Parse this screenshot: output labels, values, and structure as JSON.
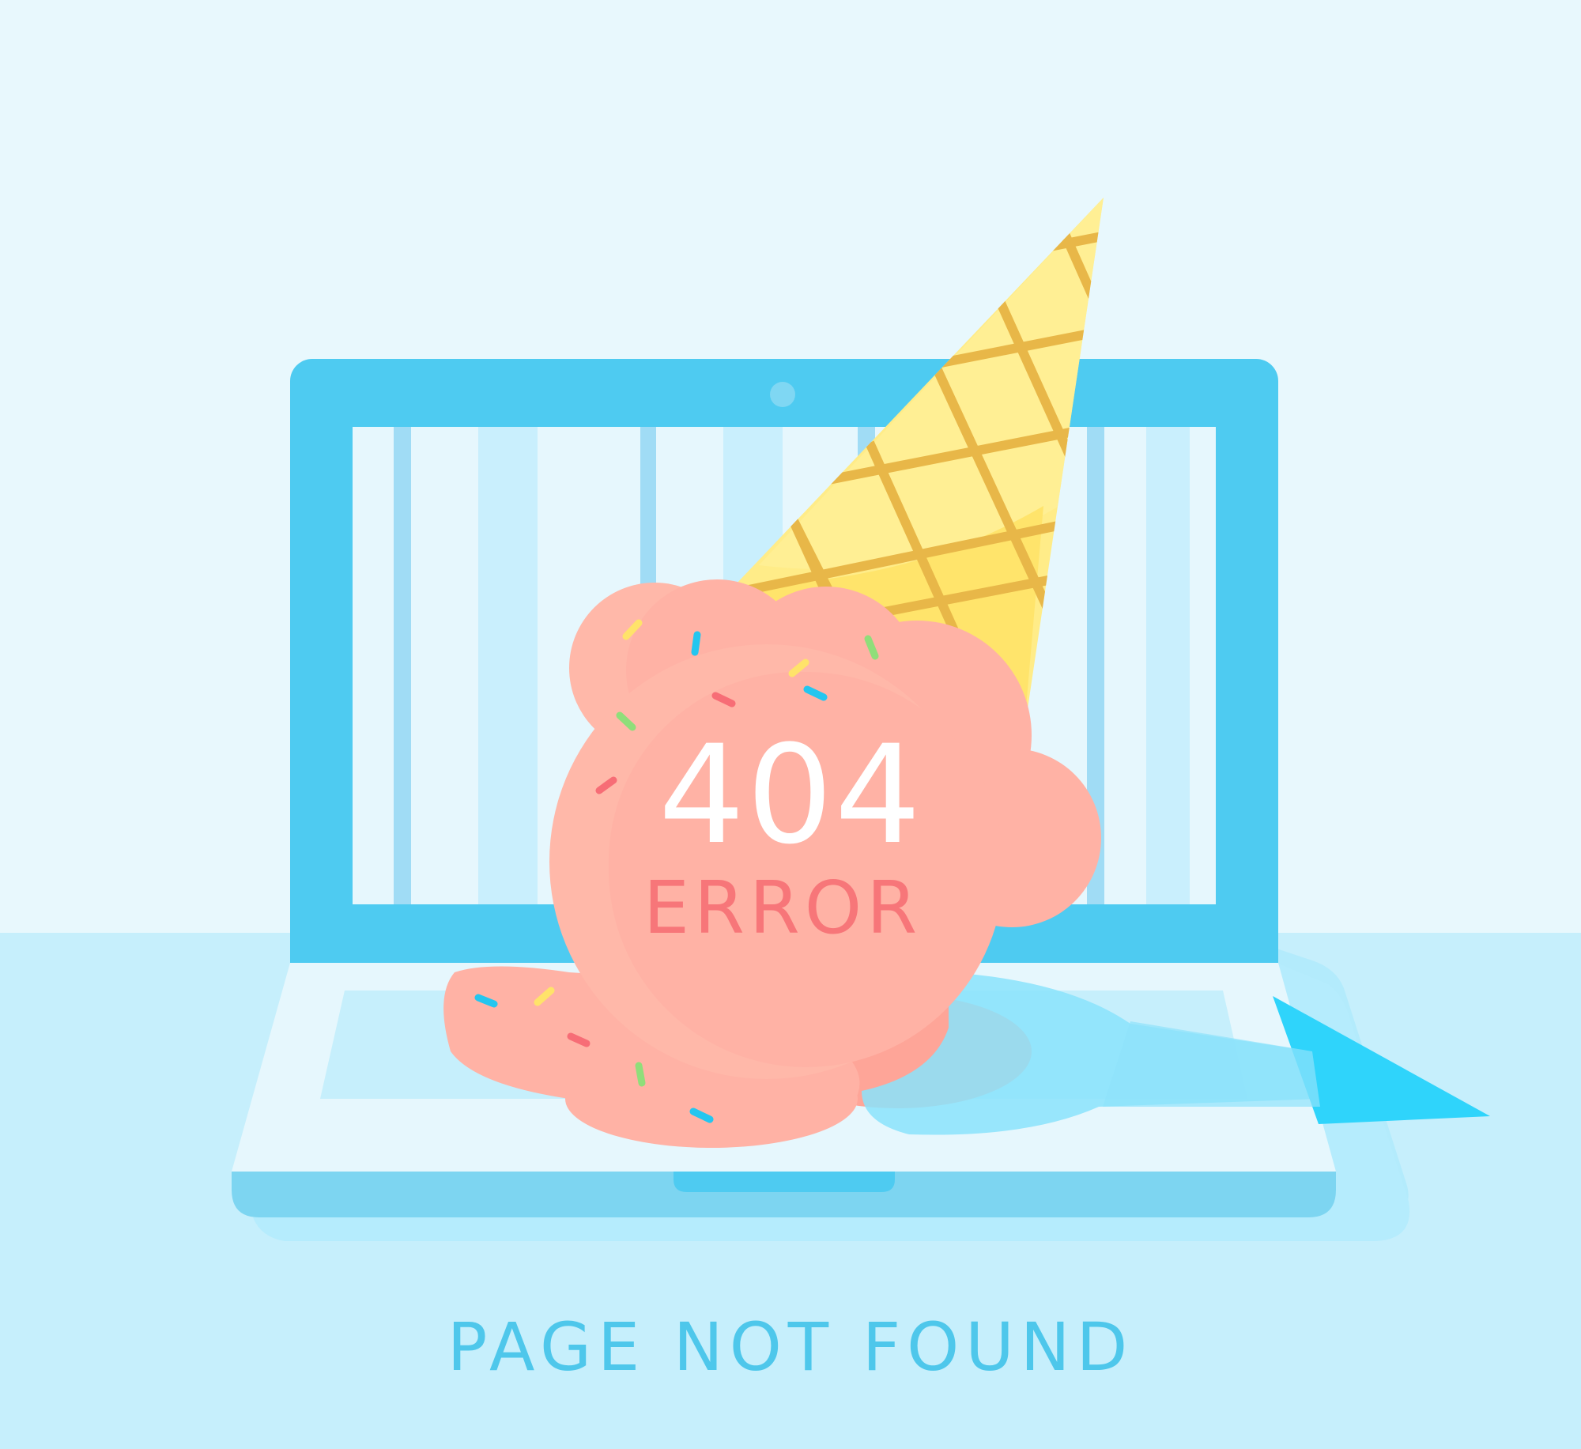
{
  "error_code": "404",
  "error_label": "ERROR",
  "message": "PAGE NOT FOUND",
  "illustration": {
    "subject": "melted ice cream cone on laptop",
    "icons": [
      "laptop-icon",
      "ice-cream-cone-icon",
      "webcam-icon"
    ]
  },
  "colors": {
    "background_top": "#e8f8fd",
    "background_floor": "#c6effc",
    "laptop_frame": "#4ecbf1",
    "ice_cream": "#ffb2a5",
    "cone": "#ffef94",
    "cone_lines": "#eab543",
    "error_text": "#f77679",
    "message_text": "#4ec7eb"
  }
}
